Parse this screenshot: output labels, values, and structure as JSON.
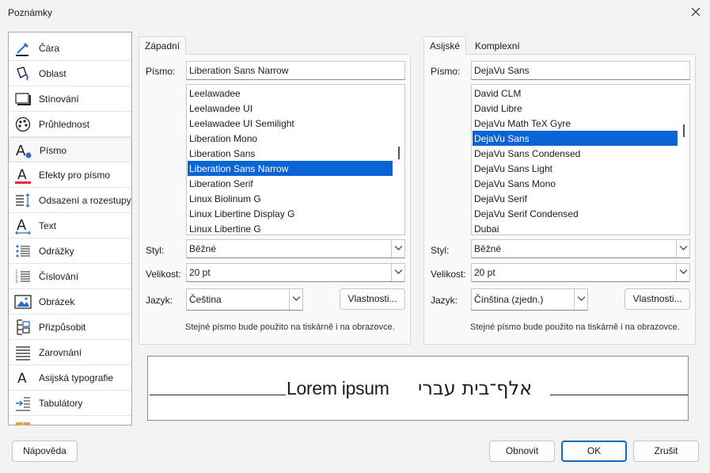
{
  "window": {
    "title": "Poznámky"
  },
  "sidebar": {
    "items": [
      {
        "label": "Čára",
        "icon": "line-icon"
      },
      {
        "label": "Oblast",
        "icon": "area-fill-icon"
      },
      {
        "label": "Stínování",
        "icon": "shadow-icon"
      },
      {
        "label": "Průhlednost",
        "icon": "transparency-icon"
      },
      {
        "label": "Písmo",
        "icon": "font-icon"
      },
      {
        "label": "Efekty pro písmo",
        "icon": "font-effects-icon"
      },
      {
        "label": "Odsazení a rozestupy",
        "icon": "indents-spacing-icon"
      },
      {
        "label": "Text",
        "icon": "text-icon"
      },
      {
        "label": "Odrážky",
        "icon": "bullets-icon"
      },
      {
        "label": "Číslování",
        "icon": "numbering-icon"
      },
      {
        "label": "Obrázek",
        "icon": "image-icon"
      },
      {
        "label": "Přizpůsobit",
        "icon": "customize-icon"
      },
      {
        "label": "Zarovnání",
        "icon": "alignment-icon"
      },
      {
        "label": "Asijská typografie",
        "icon": "asian-typography-icon"
      },
      {
        "label": "Tabulátory",
        "icon": "tabs-icon"
      }
    ],
    "selected": "Písmo"
  },
  "western": {
    "tab": "Západní",
    "font_label": "Písmo:",
    "font_value": "Liberation Sans Narrow",
    "fonts": [
      "Leelawadee",
      "Leelawadee UI",
      "Leelawadee UI Semilight",
      "Liberation Mono",
      "Liberation Sans",
      "Liberation Sans Narrow",
      "Liberation Serif",
      "Linux Biolinum G",
      "Linux Libertine Display G",
      "Linux Libertine G"
    ],
    "selected_font": "Liberation Sans Narrow",
    "style_label": "Styl:",
    "style_value": "Běžné",
    "size_label": "Velikost:",
    "size_value": "20 pt",
    "lang_label": "Jazyk:",
    "lang_value": "Čeština",
    "features_button": "Vlastnosti...",
    "hint": "Stejné písmo bude použito na tiskárně i na obrazovce."
  },
  "asian": {
    "tabs": [
      "Asijské",
      "Komplexní"
    ],
    "active_tab": "Asijské",
    "font_label": "Písmo:",
    "font_value": "DejaVu Sans",
    "fonts": [
      "David CLM",
      "David Libre",
      "DejaVu Math TeX Gyre",
      "DejaVu Sans",
      "DejaVu Sans Condensed",
      "DejaVu Sans Light",
      "DejaVu Sans Mono",
      "DejaVu Serif",
      "DejaVu Serif Condensed",
      "Dubai"
    ],
    "selected_font": "DejaVu Sans",
    "style_label": "Styl:",
    "style_value": "Běžné",
    "size_label": "Velikost:",
    "size_value": "20 pt",
    "lang_label": "Jazyk:",
    "lang_value": "Čínština (zjedn.)",
    "features_button": "Vlastnosti...",
    "hint": "Stejné písmo bude použito na tiskárně i na obrazovce."
  },
  "preview": {
    "latin_text": "Lorem ipsum",
    "ctl_text": "אלף־בית עברי"
  },
  "footer": {
    "help": "Nápověda",
    "reset": "Obnovit",
    "ok": "OK",
    "cancel": "Zrušit"
  },
  "colors": {
    "selection": "#0a64d6",
    "accent": "#0f6cbd",
    "effects_underline": "#e03131"
  }
}
